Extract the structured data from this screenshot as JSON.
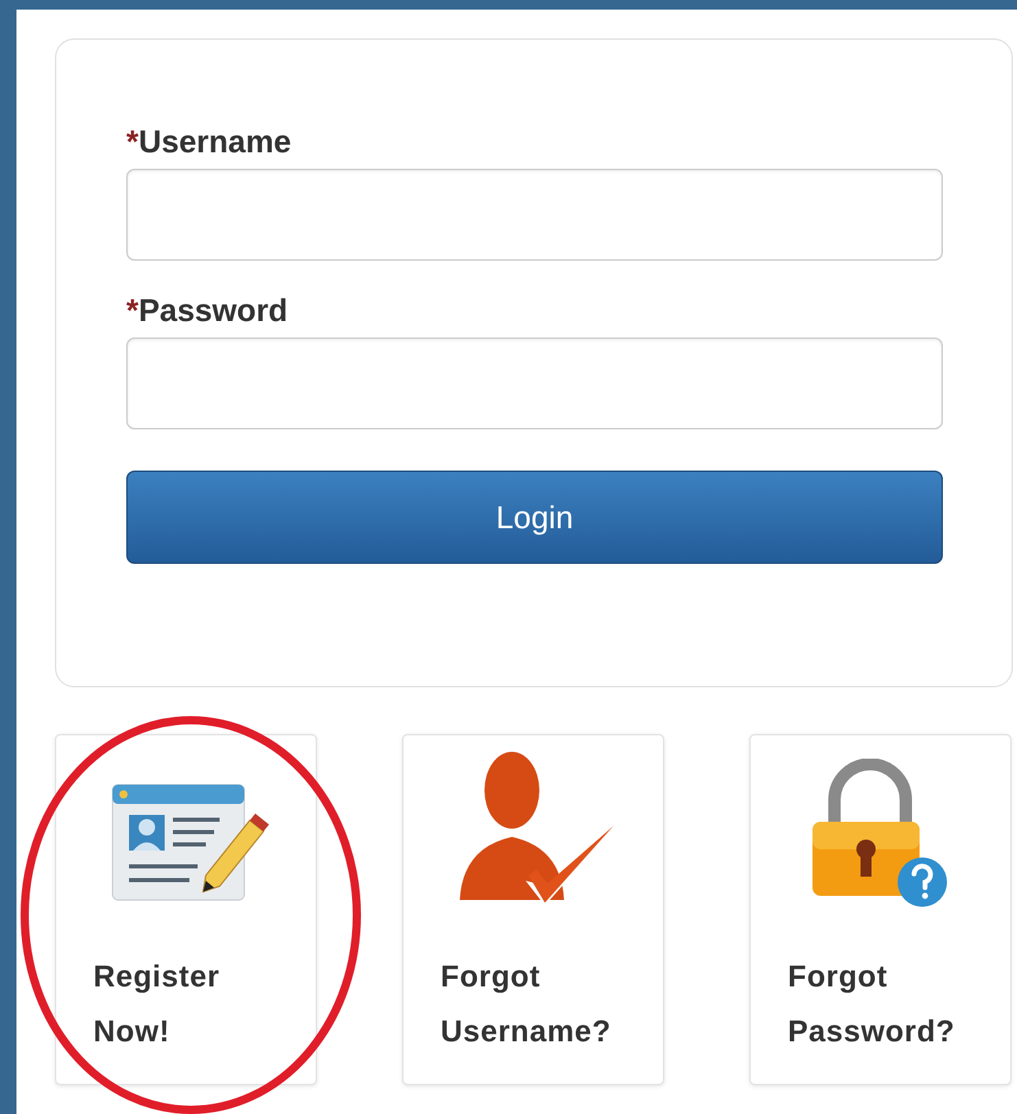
{
  "form": {
    "fields": [
      {
        "required_mark": "*",
        "label": "Username"
      },
      {
        "required_mark": "*",
        "label": "Password"
      }
    ],
    "submit": "Login"
  },
  "tiles": [
    {
      "kind": "register",
      "lines": [
        "Register",
        "Now!"
      ],
      "circled": true
    },
    {
      "kind": "user",
      "lines": [
        "Forgot",
        "Username?"
      ],
      "circled": false
    },
    {
      "kind": "lock",
      "lines": [
        "Forgot",
        "Password?"
      ],
      "circled": false
    }
  ]
}
